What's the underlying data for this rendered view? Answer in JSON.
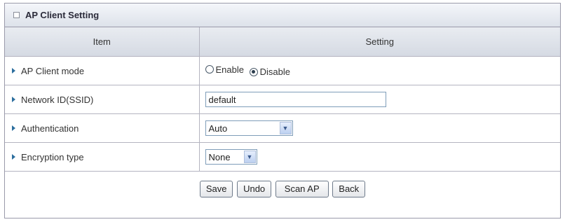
{
  "panel": {
    "title": "AP Client Setting"
  },
  "table": {
    "col_item": "Item",
    "col_setting": "Setting"
  },
  "rows": {
    "mode": {
      "label": "AP Client mode",
      "enable_label": "Enable",
      "disable_label": "Disable",
      "selected": "Disable"
    },
    "ssid": {
      "label": "Network ID(SSID)",
      "value": "default"
    },
    "auth": {
      "label": "Authentication",
      "value": "Auto"
    },
    "enc": {
      "label": "Encryption type",
      "value": "None"
    }
  },
  "buttons": {
    "save": "Save",
    "undo": "Undo",
    "scan": "Scan AP",
    "back": "Back"
  },
  "icons": {
    "title": "window-icon",
    "row_bullet": "arrow-right-icon",
    "dropdown": "chevron-down-icon"
  },
  "colors": {
    "bullet": "#2d6f9e",
    "border": "#b4b4c0",
    "header_bg": "#dde2ea"
  }
}
